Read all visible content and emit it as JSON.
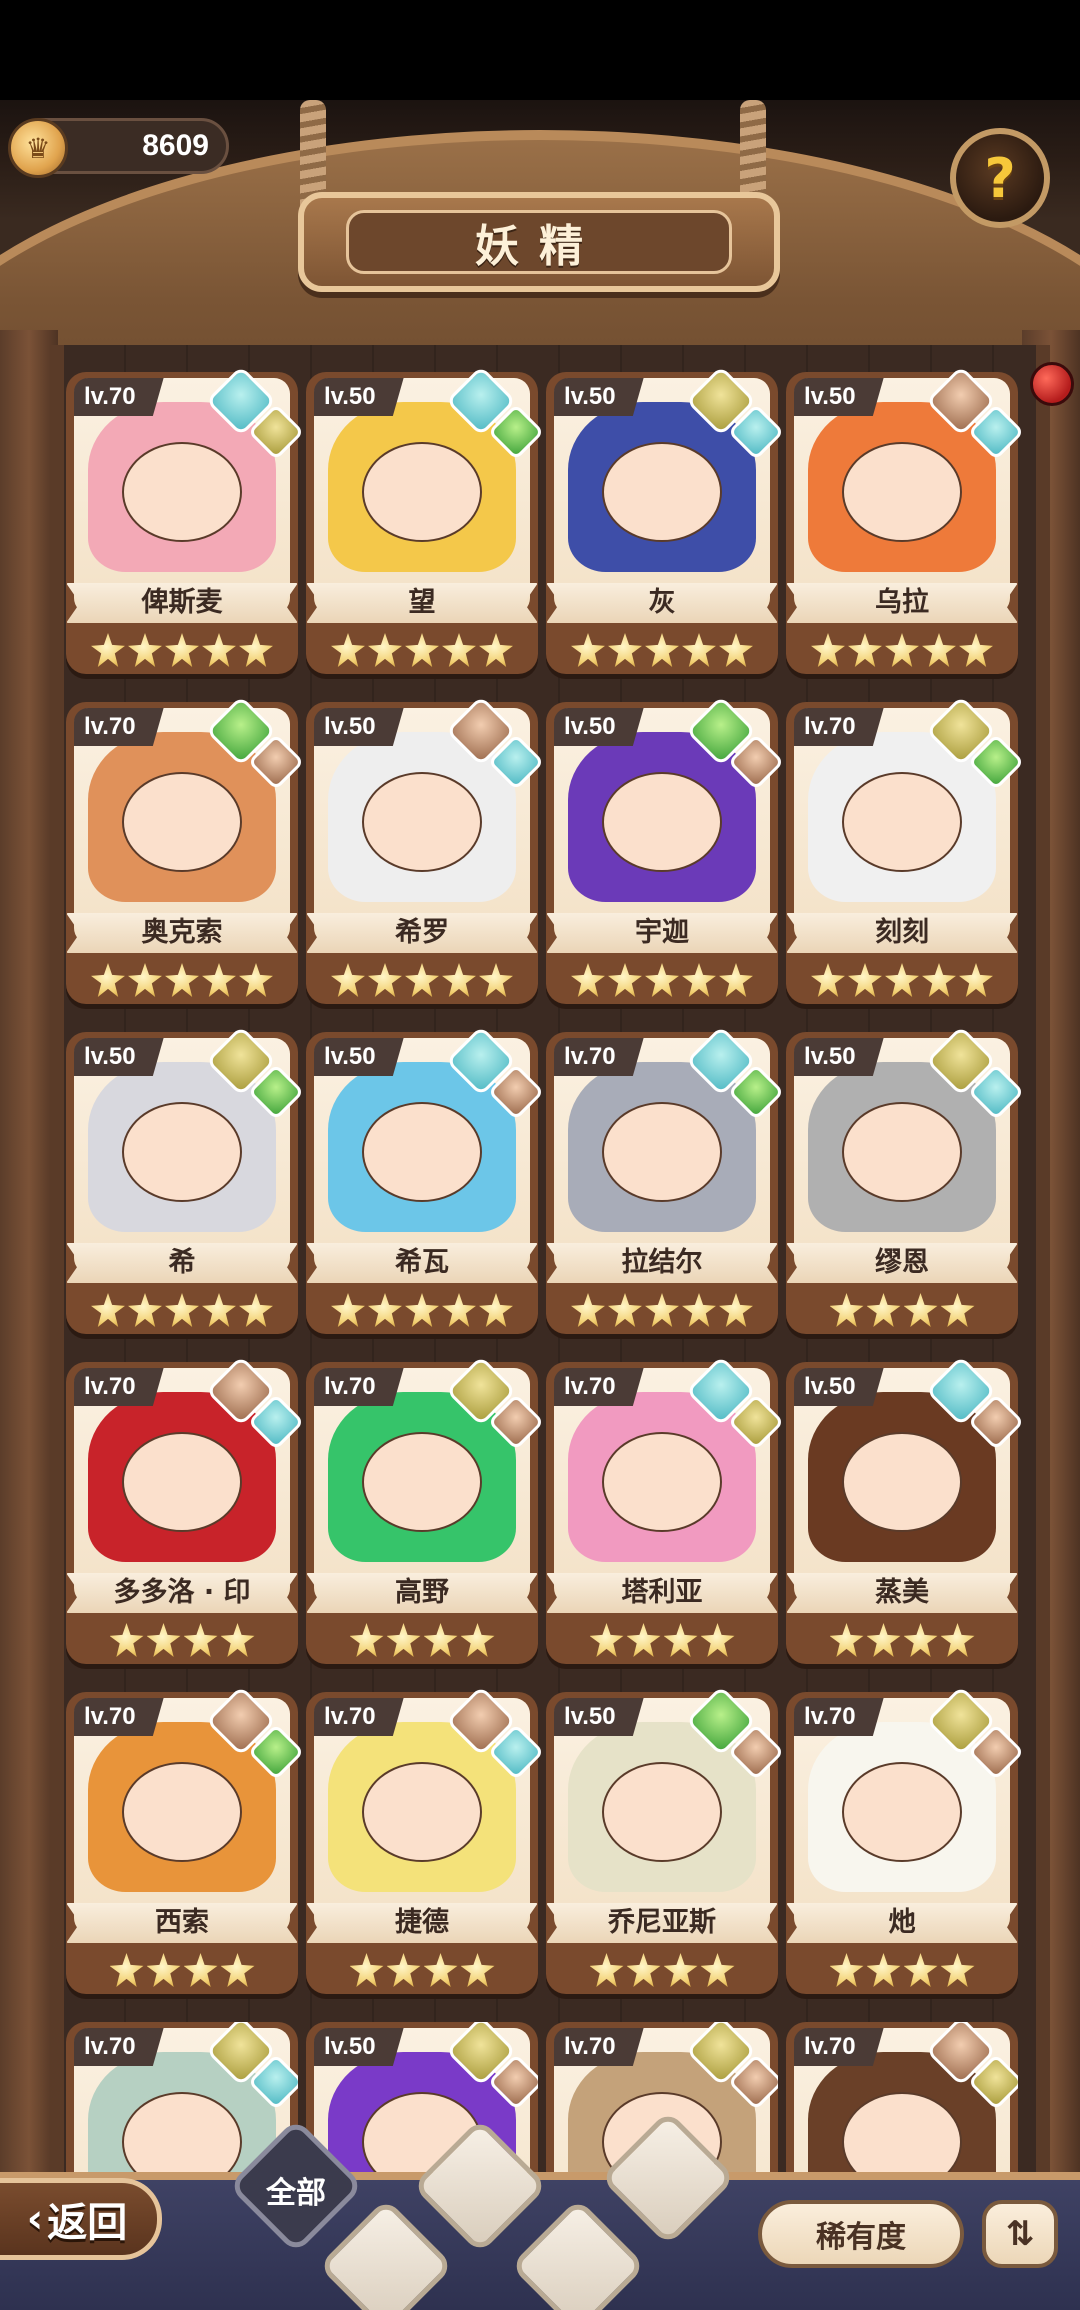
{
  "header": {
    "title": "妖精",
    "coins": "8609",
    "help_icon": "question-icon"
  },
  "cards": [
    {
      "level": "lv.70",
      "name": "俾斯麦",
      "stars": 5,
      "hair": "#f3a9b6",
      "gems": [
        "water",
        "earth"
      ]
    },
    {
      "level": "lv.50",
      "name": "望",
      "stars": 5,
      "hair": "#f4c84a",
      "gems": [
        "water",
        "wood"
      ]
    },
    {
      "level": "lv.50",
      "name": "灰",
      "stars": 5,
      "hair": "#3e4ea8",
      "gems": [
        "earth",
        "water"
      ]
    },
    {
      "level": "lv.50",
      "name": "乌拉",
      "stars": 5,
      "hair": "#ee7a3a",
      "gems": [
        "rock",
        "water"
      ]
    },
    {
      "level": "lv.70",
      "name": "奥克索",
      "stars": 5,
      "hair": "#e0915a",
      "gems": [
        "wood",
        "rock"
      ]
    },
    {
      "level": "lv.50",
      "name": "希罗",
      "stars": 5,
      "hair": "#eeeeee",
      "gems": [
        "rock",
        "water"
      ]
    },
    {
      "level": "lv.50",
      "name": "宇迦",
      "stars": 5,
      "hair": "#6b3ab8",
      "gems": [
        "wood",
        "rock"
      ]
    },
    {
      "level": "lv.70",
      "name": "刻刻",
      "stars": 5,
      "hair": "#f0f0f0",
      "gems": [
        "earth",
        "wood"
      ]
    },
    {
      "level": "lv.50",
      "name": "希",
      "stars": 5,
      "hair": "#d8d8de",
      "gems": [
        "earth",
        "wood"
      ]
    },
    {
      "level": "lv.50",
      "name": "希瓦",
      "stars": 5,
      "hair": "#6cc6e8",
      "gems": [
        "water",
        "rock"
      ]
    },
    {
      "level": "lv.70",
      "name": "拉结尔",
      "stars": 5,
      "hair": "#a8acb8",
      "gems": [
        "water",
        "wood"
      ]
    },
    {
      "level": "lv.50",
      "name": "缪恩",
      "stars": 4,
      "hair": "#b0b0b0",
      "gems": [
        "earth",
        "water"
      ]
    },
    {
      "level": "lv.70",
      "name": "多多洛 · 印",
      "stars": 4,
      "hair": "#c8232a",
      "gems": [
        "rock",
        "water"
      ]
    },
    {
      "level": "lv.70",
      "name": "高野",
      "stars": 4,
      "hair": "#36c46a",
      "gems": [
        "earth",
        "rock"
      ]
    },
    {
      "level": "lv.70",
      "name": "塔利亚",
      "stars": 4,
      "hair": "#f19ac0",
      "gems": [
        "water",
        "earth"
      ]
    },
    {
      "level": "lv.50",
      "name": "蒸美",
      "stars": 4,
      "hair": "#6a3a22",
      "gems": [
        "water",
        "rock"
      ]
    },
    {
      "level": "lv.70",
      "name": "西索",
      "stars": 4,
      "hair": "#e8943a",
      "gems": [
        "rock",
        "wood"
      ]
    },
    {
      "level": "lv.70",
      "name": "捷德",
      "stars": 4,
      "hair": "#f4e27a",
      "gems": [
        "rock",
        "water"
      ]
    },
    {
      "level": "lv.50",
      "name": "乔尼亚斯",
      "stars": 4,
      "hair": "#e6e2c8",
      "gems": [
        "wood",
        "rock"
      ]
    },
    {
      "level": "lv.70",
      "name": "灺",
      "stars": 4,
      "hair": "#f8f6ee",
      "gems": [
        "earth",
        "rock"
      ]
    },
    {
      "level": "lv.70",
      "name": "",
      "stars": 0,
      "hair": "#b6d0c2",
      "gems": [
        "earth",
        "water"
      ]
    },
    {
      "level": "lv.50",
      "name": "",
      "stars": 0,
      "hair": "#7a3ac8",
      "gems": [
        "earth",
        "rock"
      ]
    },
    {
      "level": "lv.70",
      "name": "",
      "stars": 0,
      "hair": "#c4a27a",
      "gems": [
        "earth",
        "rock"
      ]
    },
    {
      "level": "lv.70",
      "name": "",
      "stars": 0,
      "hair": "#6a4028",
      "gems": [
        "rock",
        "earth"
      ]
    }
  ],
  "bottom": {
    "back_label": "返回",
    "filter_all_label": "全部",
    "sort_label": "稀有度",
    "order_icon": "sort-order-icon"
  }
}
